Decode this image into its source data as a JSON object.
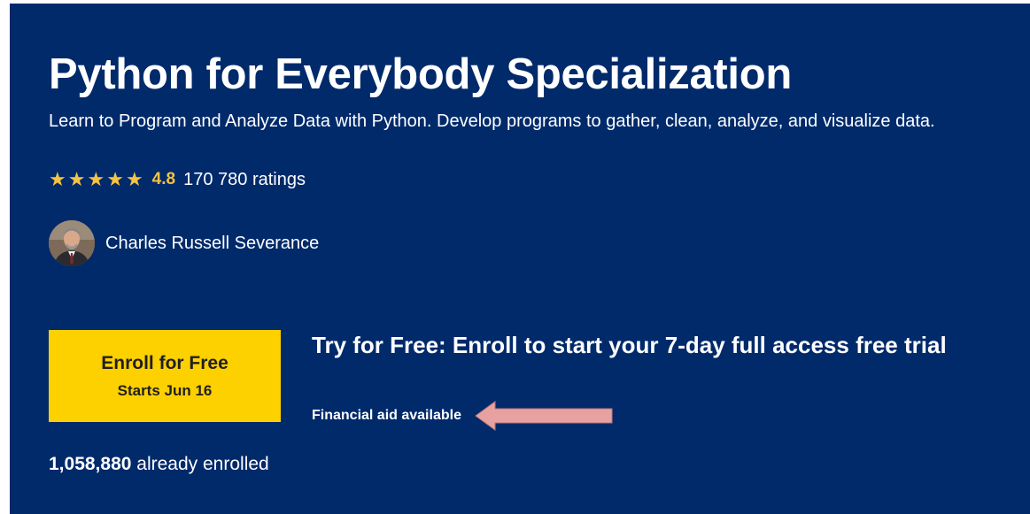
{
  "hero": {
    "title": "Python for Everybody Specialization",
    "subtitle": "Learn to Program and Analyze Data with Python. Develop programs to gather, clean, analyze, and visualize data.",
    "rating": {
      "value": "4.8",
      "count_text": "170 780 ratings",
      "stars_filled": 5,
      "star_color": "#f5c242"
    },
    "instructor": {
      "name": "Charles Russell Severance"
    },
    "enroll": {
      "label": "Enroll for Free",
      "starts": "Starts Jun 16",
      "button_color": "#fdd000"
    },
    "trial_text": "Try for Free: Enroll to start your 7-day full access free trial",
    "financial_aid": "Financial aid available",
    "enrolled": {
      "count": "1,058,880",
      "suffix": "already enrolled"
    },
    "background_color": "#012a6b",
    "annotation_arrow_color": "#e8a1a1"
  }
}
